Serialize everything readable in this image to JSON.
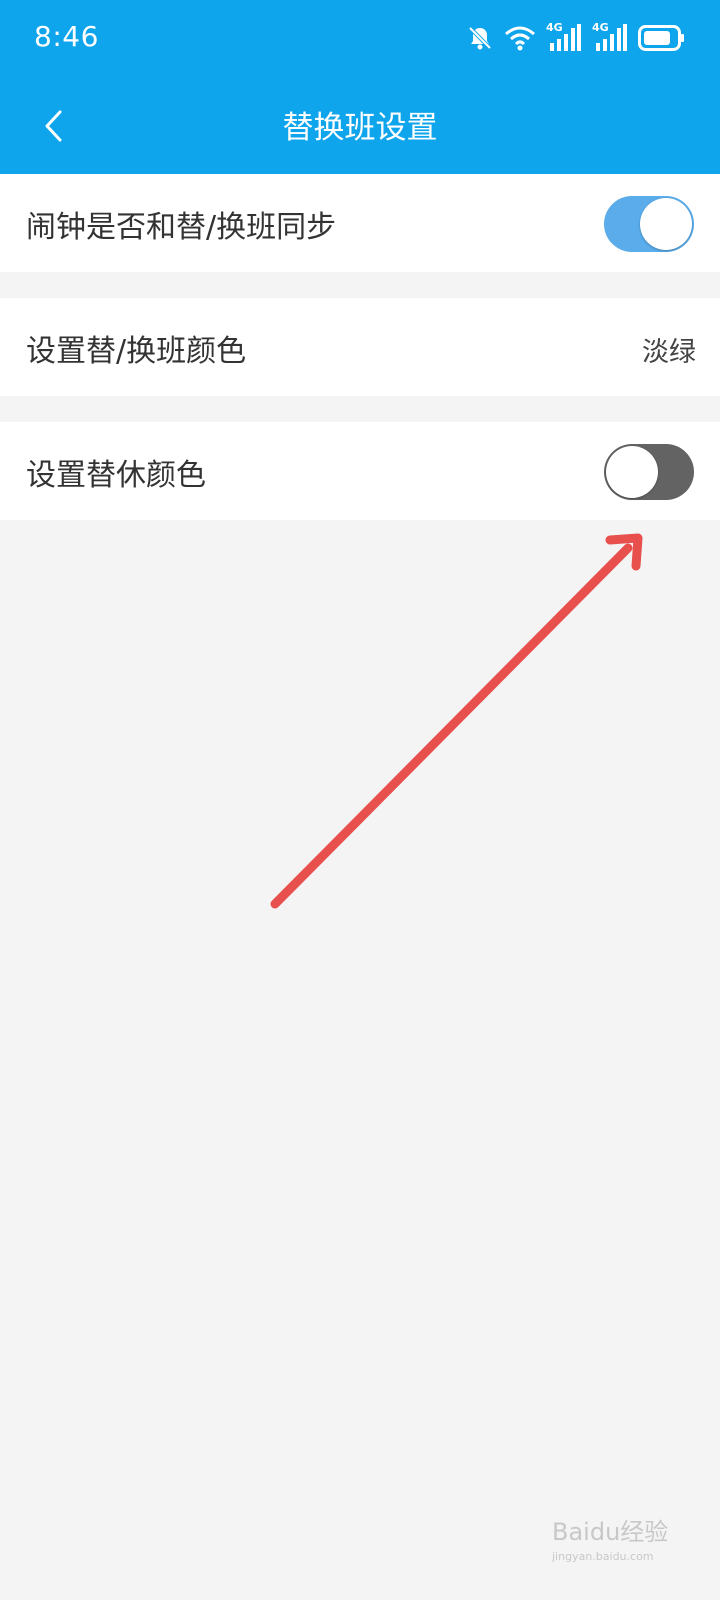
{
  "status_bar": {
    "time": "8:46",
    "icons": [
      "mute-bell-icon",
      "wifi-icon",
      "signal-4g-icon",
      "signal-4g-icon",
      "battery-icon"
    ],
    "signal_label": "4G"
  },
  "header": {
    "title": "替换班设置",
    "back_icon": "chevron-left-icon",
    "background": "#0ea5ec"
  },
  "settings": [
    {
      "label": "闹钟是否和替/换班同步",
      "control": "toggle",
      "checked": true
    },
    {
      "label": "设置替/换班颜色",
      "control": "value",
      "value": "淡绿"
    },
    {
      "label": "设置替休颜色",
      "control": "toggle",
      "checked": false
    }
  ],
  "colors": {
    "toggle_on": "#5aacea",
    "toggle_off": "#636363",
    "annotation_arrow": "#e8504e"
  },
  "watermark": {
    "main": "Baidu经验",
    "sub": "jingyan.baidu.com"
  }
}
